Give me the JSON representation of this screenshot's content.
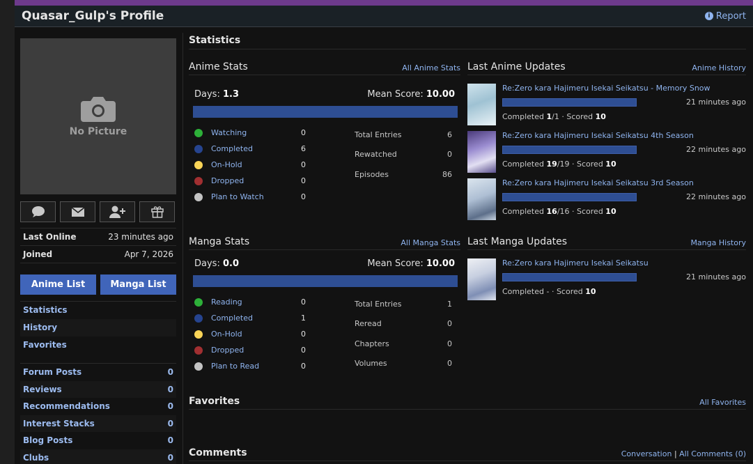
{
  "header": {
    "title": "Quasar_Gulp's Profile",
    "report_label": "Report"
  },
  "sidebar": {
    "no_picture_label": "No Picture",
    "last_online_label": "Last Online",
    "last_online_value": "23 minutes ago",
    "joined_label": "Joined",
    "joined_value": "Apr 7, 2026",
    "anime_list_label": "Anime List",
    "manga_list_label": "Manga List",
    "nav": [
      "Statistics",
      "History",
      "Favorites"
    ],
    "counts": [
      {
        "label": "Forum Posts",
        "value": "0"
      },
      {
        "label": "Reviews",
        "value": "0"
      },
      {
        "label": "Recommendations",
        "value": "0"
      },
      {
        "label": "Interest Stacks",
        "value": "0"
      },
      {
        "label": "Blog Posts",
        "value": "0"
      },
      {
        "label": "Clubs",
        "value": "0"
      }
    ]
  },
  "main": {
    "statistics_title": "Statistics",
    "anime_stats": {
      "title": "Anime Stats",
      "link": "All Anime Stats",
      "days_label": "Days:",
      "days_value": "1.3",
      "mean_label": "Mean Score:",
      "mean_value": "10.00",
      "statuses": [
        {
          "label": "Watching",
          "value": "0",
          "color": "#2db039"
        },
        {
          "label": "Completed",
          "value": "6",
          "color": "#26448f"
        },
        {
          "label": "On-Hold",
          "value": "0",
          "color": "#f9d457"
        },
        {
          "label": "Dropped",
          "value": "0",
          "color": "#a12f31"
        },
        {
          "label": "Plan to Watch",
          "value": "0",
          "color": "#c3c3c3"
        }
      ],
      "totals": [
        {
          "label": "Total Entries",
          "value": "6"
        },
        {
          "label": "Rewatched",
          "value": "0"
        },
        {
          "label": "Episodes",
          "value": "86"
        }
      ]
    },
    "manga_stats": {
      "title": "Manga Stats",
      "link": "All Manga Stats",
      "days_label": "Days:",
      "days_value": "0.0",
      "mean_label": "Mean Score:",
      "mean_value": "10.00",
      "statuses": [
        {
          "label": "Reading",
          "value": "0",
          "color": "#2db039"
        },
        {
          "label": "Completed",
          "value": "1",
          "color": "#26448f"
        },
        {
          "label": "On-Hold",
          "value": "0",
          "color": "#f9d457"
        },
        {
          "label": "Dropped",
          "value": "0",
          "color": "#a12f31"
        },
        {
          "label": "Plan to Read",
          "value": "0",
          "color": "#c3c3c3"
        }
      ],
      "totals": [
        {
          "label": "Total Entries",
          "value": "1"
        },
        {
          "label": "Reread",
          "value": "0"
        },
        {
          "label": "Chapters",
          "value": "0"
        },
        {
          "label": "Volumes",
          "value": "0"
        }
      ]
    },
    "anime_updates": {
      "title": "Last Anime Updates",
      "link": "Anime History",
      "items": [
        {
          "title": "Re:Zero kara Hajimeru Isekai Seikatsu - Memory Snow",
          "time": "21 minutes ago",
          "status_prefix": "Completed ",
          "progress": "1",
          "progress_total": "/1 · Scored ",
          "score": "10"
        },
        {
          "title": "Re:Zero kara Hajimeru Isekai Seikatsu 4th Season",
          "time": "22 minutes ago",
          "status_prefix": "Completed ",
          "progress": "19",
          "progress_total": "/19 · Scored ",
          "score": "10"
        },
        {
          "title": "Re:Zero kara Hajimeru Isekai Seikatsu 3rd Season",
          "time": "22 minutes ago",
          "status_prefix": "Completed ",
          "progress": "16",
          "progress_total": "/16 · Scored ",
          "score": "10"
        }
      ]
    },
    "manga_updates": {
      "title": "Last Manga Updates",
      "link": "Manga History",
      "items": [
        {
          "title": "Re:Zero kara Hajimeru Isekai Seikatsu",
          "time": "21 minutes ago",
          "status_prefix": "Completed - · Scored ",
          "score": "10"
        }
      ]
    },
    "favorites_title": "Favorites",
    "favorites_link": "All Favorites",
    "comments_title": "Comments",
    "conversation_link": "Conversation",
    "all_comments_link": "All Comments (0)",
    "comments_separator": "|"
  }
}
